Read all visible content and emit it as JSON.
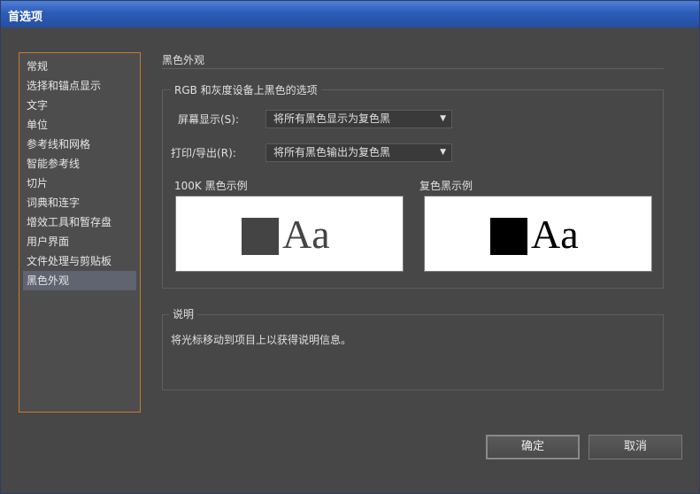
{
  "window": {
    "title": "首选项"
  },
  "sidebar": {
    "items": [
      {
        "label": "常规"
      },
      {
        "label": "选择和锚点显示"
      },
      {
        "label": "文字"
      },
      {
        "label": "单位"
      },
      {
        "label": "参考线和网格"
      },
      {
        "label": "智能参考线"
      },
      {
        "label": "切片"
      },
      {
        "label": "词典和连字"
      },
      {
        "label": "增效工具和暂存盘"
      },
      {
        "label": "用户界面"
      },
      {
        "label": "文件处理与剪贴板"
      },
      {
        "label": "黑色外观",
        "selected": true
      }
    ]
  },
  "main": {
    "section_title": "黑色外观",
    "group_title": "RGB 和灰度设备上黑色的选项",
    "screen": {
      "label": "屏幕显示(S):",
      "value": "将所有黑色显示为复色黑"
    },
    "print": {
      "label": "打印/导出(R):",
      "value": "将所有黑色输出为复色黑"
    },
    "sample_100k": {
      "label": "100K 黑色示例",
      "text": "Aa",
      "swatch_color": "#444444"
    },
    "sample_rich": {
      "label": "复色黑示例",
      "text": "Aa",
      "swatch_color": "#000000"
    },
    "description": {
      "title": "说明",
      "text": "将光标移动到项目上以获得说明信息。"
    }
  },
  "buttons": {
    "ok": "确定",
    "cancel": "取消"
  },
  "colors": {
    "sidebar_border": "#c77a2c",
    "selected_item": "#5f6470",
    "titlebar": "#2d5cb8"
  }
}
